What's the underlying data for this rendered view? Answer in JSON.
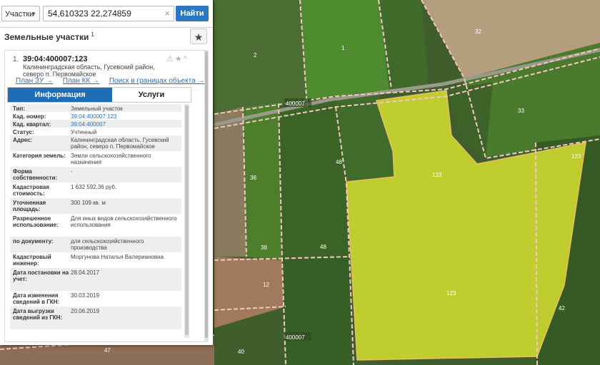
{
  "search": {
    "type_label": "Участки",
    "query": "54,610323 22,274859",
    "clear_glyph": "×",
    "button_label": "Найти"
  },
  "panel": {
    "title": "Земельные участки",
    "title_sup": "1",
    "star_glyph": "★"
  },
  "item": {
    "number": "1.",
    "cadastral_number": "39:04:400007:123",
    "icons": "⚠★^",
    "address": "Калининградская область, Гусевский район, северо п. Первомайское",
    "links": [
      "План ЗУ →",
      "План КК →",
      "Поиск в границах объекта →"
    ]
  },
  "tabs": {
    "info": "Информация",
    "services": "Услуги"
  },
  "info_rows": [
    {
      "key": "Тип:",
      "value": "Земельный участок"
    },
    {
      "key": "Кад. номер:",
      "value": "39:04:400007:123"
    },
    {
      "key": "Кад. квартал:",
      "value": "39:04:400007"
    },
    {
      "key": "Статус:",
      "value": "Учтенный"
    },
    {
      "key": "Адрес:",
      "value": "Калининградская область, Гусевский район, северо п. Первомайское"
    },
    {
      "key": "Категория земель:",
      "value": "Земли сельскохозяйственного назначения"
    },
    {
      "key": "Форма собственности:",
      "value": "-"
    },
    {
      "key": "Кадастровая стоимость:",
      "value": "1 632 592,36 руб."
    },
    {
      "key": "Уточненная площадь:",
      "value": "300 109 кв. м"
    },
    {
      "key": "Разрешенное использование:",
      "value": "Для иных видов сельскохозяйственного использования"
    },
    {
      "key": "по документу:",
      "value": "для сельскохозяйственного производства"
    },
    {
      "key": "Кадастровый инженер:",
      "value": "Моргунова Наталья Валериановна"
    },
    {
      "key": "Дата постановки на учет:",
      "value": "28.04.2017"
    },
    {
      "key": "Дата изменения сведений в ГКН:",
      "value": "30.03.2019"
    },
    {
      "key": "Дата выгрузки сведений из ГКН:",
      "value": "20.06.2019"
    }
  ],
  "map_labels": {
    "quarter_top": "400007",
    "quarter_bottom": "400007",
    "parcels": [
      "32",
      "1",
      "2",
      "33",
      "123",
      "123",
      "123",
      "48",
      "38",
      "38",
      "48",
      "12",
      "42",
      "40",
      "47"
    ]
  },
  "colors": {
    "accent": "#1f6db5",
    "highlight": "#d6e030",
    "boundary": "#f5c6c6"
  }
}
